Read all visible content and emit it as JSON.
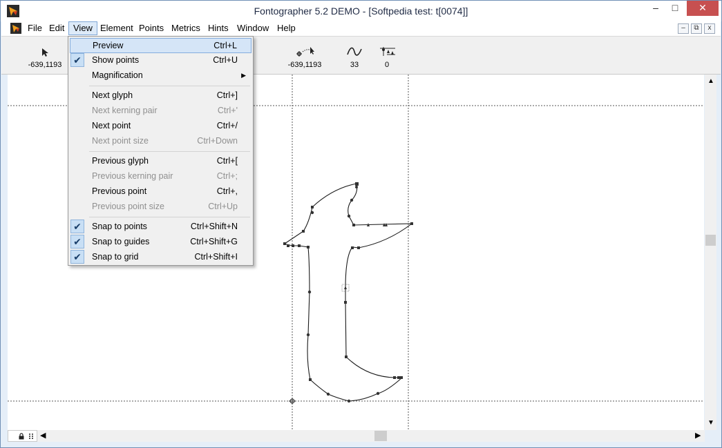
{
  "window": {
    "title": "Fontographer 5.2 DEMO - [Softpedia test: t[0074]]",
    "controls": {
      "minimize": "–",
      "maximize": "□",
      "close": "✕"
    }
  },
  "menubar": {
    "items": [
      "File",
      "Edit",
      "View",
      "Element",
      "Points",
      "Metrics",
      "Hints",
      "Window",
      "Help"
    ],
    "active": "View",
    "mdi_controls": {
      "minimize": "–",
      "restore": "⧉",
      "close": "x"
    }
  },
  "toolbar": {
    "pointer_coords": "-639,1193",
    "point_coords": "-639,1193",
    "curve_value": "33",
    "hint_value": "0"
  },
  "view_menu": {
    "items": [
      {
        "label": "Preview",
        "shortcut": "Ctrl+L",
        "checked": false,
        "disabled": false,
        "highlighted": true
      },
      {
        "label": "Show points",
        "shortcut": "Ctrl+U",
        "checked": true,
        "disabled": false
      },
      {
        "label": "Magnification",
        "shortcut": "",
        "submenu": true,
        "disabled": false
      },
      {
        "label": "Next glyph",
        "shortcut": "Ctrl+]",
        "disabled": false
      },
      {
        "label": "Next kerning pair",
        "shortcut": "Ctrl+'",
        "disabled": true
      },
      {
        "label": "Next point",
        "shortcut": "Ctrl+/",
        "disabled": false
      },
      {
        "label": "Next point size",
        "shortcut": "Ctrl+Down",
        "disabled": true
      },
      {
        "label": "Previous glyph",
        "shortcut": "Ctrl+[",
        "disabled": false
      },
      {
        "label": "Previous kerning pair",
        "shortcut": "Ctrl+;",
        "disabled": true
      },
      {
        "label": "Previous point",
        "shortcut": "Ctrl+,",
        "disabled": false
      },
      {
        "label": "Previous point size",
        "shortcut": "Ctrl+Up",
        "disabled": true
      },
      {
        "label": "Snap to points",
        "shortcut": "Ctrl+Shift+N",
        "checked": true,
        "disabled": false
      },
      {
        "label": "Snap to guides",
        "shortcut": "Ctrl+Shift+G",
        "checked": true,
        "disabled": false
      },
      {
        "label": "Snap to grid",
        "shortcut": "Ctrl+Shift+I",
        "checked": true,
        "disabled": false
      }
    ],
    "check_glyph": "✔",
    "submenu_arrow": "▶"
  },
  "icons": {
    "app": "fontographer-logo-icon",
    "pointer": "arrow-pointer-icon",
    "point_tool": "point-cursor-icon",
    "curve": "curve-icon",
    "hint": "hint-points-icon",
    "lock": "lock-icon"
  },
  "colors": {
    "close_button": "#c75050",
    "menu_highlight": "#d5e5f7",
    "outline": "#1a1a1a"
  }
}
